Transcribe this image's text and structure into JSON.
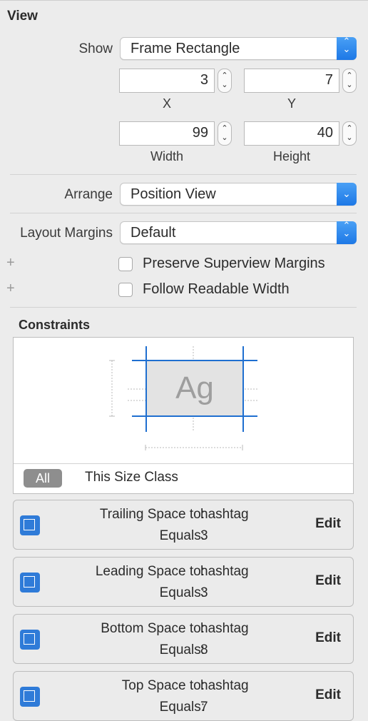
{
  "view": {
    "title": "View",
    "show_label": "Show",
    "show_value": "Frame Rectangle",
    "x_value": "3",
    "y_value": "7",
    "x_caption": "X",
    "y_caption": "Y",
    "width_value": "99",
    "height_value": "40",
    "width_caption": "Width",
    "height_caption": "Height",
    "arrange_label": "Arrange",
    "arrange_value": "Position View",
    "margins_label": "Layout Margins",
    "margins_value": "Default",
    "preserve_label": "Preserve Superview Margins",
    "readable_label": "Follow Readable Width",
    "preserve_checked": false,
    "readable_checked": false
  },
  "constraints": {
    "title": "Constraints",
    "preview_text": "Ag",
    "all_button": "All",
    "size_class_label": "This Size Class",
    "items": [
      {
        "label": "Trailing Space to:",
        "target": "hashtag",
        "equals_label": "Equals:",
        "value": "3",
        "edit": "Edit",
        "icon": "trailing-space-icon"
      },
      {
        "label": "Leading Space to:",
        "target": "hashtag",
        "equals_label": "Equals:",
        "value": "3",
        "edit": "Edit",
        "icon": "leading-space-icon"
      },
      {
        "label": "Bottom Space to:",
        "target": "hashtag",
        "equals_label": "Equals:",
        "value": "8",
        "edit": "Edit",
        "icon": "bottom-space-icon"
      },
      {
        "label": "Top Space to:",
        "target": "hashtag",
        "equals_label": "Equals:",
        "value": "7",
        "edit": "Edit",
        "icon": "top-space-icon"
      }
    ]
  },
  "colors": {
    "accent": "#1d78e6",
    "icon_blue": "#2f7bd8",
    "guide_blue": "#1f6fd0"
  }
}
